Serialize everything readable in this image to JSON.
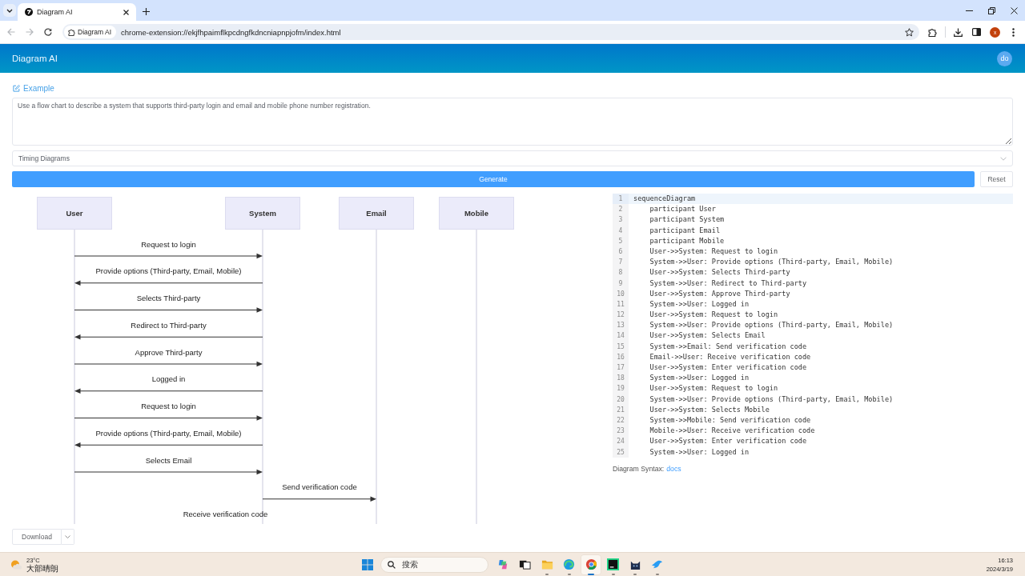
{
  "browser": {
    "tab": {
      "title": "Diagram AI",
      "selected": true
    },
    "nav": [
      {
        "kind": "back",
        "disabled": true
      },
      {
        "kind": "forward",
        "disabled": true
      },
      {
        "kind": "reload",
        "disabled": false
      }
    ],
    "site_chip": "Diagram AI",
    "url": "chrome-extension://ekjfhpaimflkpcdngfkdncniapnpjofm/index.html",
    "profile_initial": "x"
  },
  "app_header": {
    "title": "Diagram AI",
    "avatar": "do"
  },
  "example_link": "Example",
  "prompt": {
    "value": "Use a flow chart to describe a system that supports third-party login and email and mobile phone number registration."
  },
  "diagram_type": {
    "value": "Timing Diagrams"
  },
  "actions": {
    "generate": "Generate",
    "reset": "Reset"
  },
  "diagram": {
    "participants": [
      {
        "name": "User"
      },
      {
        "name": "System"
      },
      {
        "name": "Email"
      },
      {
        "name": "Mobile"
      }
    ],
    "messages": [
      {
        "text": "Request to login",
        "kind": "user-system"
      },
      {
        "text": "Provide options (Third-party, Email, Mobile)",
        "kind": "system-user"
      },
      {
        "text": "Selects Third-party",
        "kind": "user-system"
      },
      {
        "text": "Redirect to Third-party",
        "kind": "system-user"
      },
      {
        "text": "Approve Third-party",
        "kind": "user-system"
      },
      {
        "text": "Logged in",
        "kind": "system-user"
      },
      {
        "text": "Request to login",
        "kind": "user-system"
      },
      {
        "text": "Provide options (Third-party, Email, Mobile)",
        "kind": "system-user"
      },
      {
        "text": "Selects Email",
        "kind": "user-system"
      },
      {
        "text": "Send verification code",
        "kind": "system-email"
      },
      {
        "text": "Receive verification code",
        "kind": "email-user"
      }
    ]
  },
  "editor": {
    "lines": [
      {
        "number": "1",
        "text": "sequenceDiagram",
        "active": true
      },
      {
        "number": "2",
        "text": "    participant User",
        "active": false
      },
      {
        "number": "3",
        "text": "    participant System",
        "active": false
      },
      {
        "number": "4",
        "text": "    participant Email",
        "active": false
      },
      {
        "number": "5",
        "text": "    participant Mobile",
        "active": false
      },
      {
        "number": "6",
        "text": "    User->>System: Request to login",
        "active": false
      },
      {
        "number": "7",
        "text": "    System->>User: Provide options (Third-party, Email, Mobile)",
        "active": false
      },
      {
        "number": "8",
        "text": "    User->>System: Selects Third-party",
        "active": false
      },
      {
        "number": "9",
        "text": "    System->>User: Redirect to Third-party",
        "active": false
      },
      {
        "number": "10",
        "text": "    User->>System: Approve Third-party",
        "active": false
      },
      {
        "number": "11",
        "text": "    System->>User: Logged in",
        "active": false
      },
      {
        "number": "12",
        "text": "    User->>System: Request to login",
        "active": false
      },
      {
        "number": "13",
        "text": "    System->>User: Provide options (Third-party, Email, Mobile)",
        "active": false
      },
      {
        "number": "14",
        "text": "    User->>System: Selects Email",
        "active": false
      },
      {
        "number": "15",
        "text": "    System->>Email: Send verification code",
        "active": false
      },
      {
        "number": "16",
        "text": "    Email->>User: Receive verification code",
        "active": false
      },
      {
        "number": "17",
        "text": "    User->>System: Enter verification code",
        "active": false
      },
      {
        "number": "18",
        "text": "    System->>User: Logged in",
        "active": false
      },
      {
        "number": "19",
        "text": "    User->>System: Request to login",
        "active": false
      },
      {
        "number": "20",
        "text": "    System->>User: Provide options (Third-party, Email, Mobile)",
        "active": false
      },
      {
        "number": "21",
        "text": "    User->>System: Selects Mobile",
        "active": false
      },
      {
        "number": "22",
        "text": "    System->>Mobile: Send verification code",
        "active": false
      },
      {
        "number": "23",
        "text": "    Mobile->>User: Receive verification code",
        "active": false
      },
      {
        "number": "24",
        "text": "    User->>System: Enter verification code",
        "active": false
      },
      {
        "number": "25",
        "text": "    System->>User: Logged in",
        "active": false
      }
    ]
  },
  "syntax_note": {
    "label": "Diagram Syntax:",
    "link": "docs"
  },
  "download": {
    "label": "Download"
  },
  "taskbar": {
    "weather": {
      "temperature": "23°C",
      "condition": "大部晴朗"
    },
    "search": {
      "placeholder": "搜索"
    },
    "apps": [
      {
        "kind": "sparkle-blob",
        "running": false,
        "active": false
      },
      {
        "kind": "task-view",
        "running": false,
        "active": false
      },
      {
        "kind": "folder",
        "running": true,
        "active": false
      },
      {
        "kind": "swirl",
        "running": true,
        "active": false
      },
      {
        "kind": "ring",
        "running": true,
        "active": true
      },
      {
        "kind": "dark-tile",
        "running": true,
        "active": false
      },
      {
        "kind": "cat",
        "running": true,
        "active": false
      },
      {
        "kind": "bird",
        "running": true,
        "active": false
      }
    ],
    "clock": {
      "time": "16:13",
      "date": "2024/3/19"
    }
  }
}
